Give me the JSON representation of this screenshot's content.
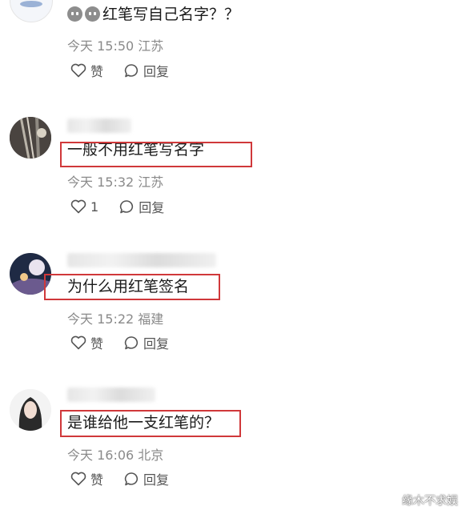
{
  "comments": [
    {
      "text": "红笔写自己名字？？",
      "time": "今天 15:50",
      "location": "江苏",
      "like_label": "赞",
      "reply_label": "回复",
      "emoji_icons": [
        "doge-face-icon",
        "doge-face-icon"
      ]
    },
    {
      "text": "一般不用红笔写名字",
      "time": "今天 15:32",
      "location": "江苏",
      "like_label": "1",
      "reply_label": "回复"
    },
    {
      "text": "为什么用红笔签名",
      "time": "今天 15:22",
      "location": "福建",
      "like_label": "赞",
      "reply_label": "回复"
    },
    {
      "text": "是谁给他一支红笔的？",
      "time": "今天 16:06",
      "location": "北京",
      "like_label": "赞",
      "reply_label": "回复"
    }
  ],
  "watermark": "缘木不求娱",
  "colors": {
    "highlight_box": "#d0383a",
    "meta_text": "#8a8a8a"
  }
}
